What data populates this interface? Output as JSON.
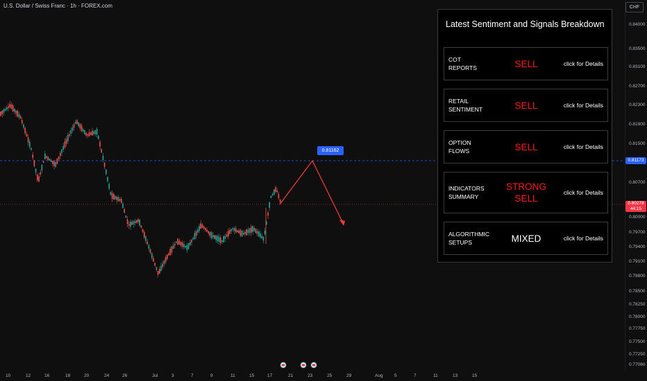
{
  "chart": {
    "title": "U.S. Dollar / Swiss Franc · 1h · FOREX.com",
    "currency": "CHF",
    "price_labels": [
      "0.84000",
      "0.83500",
      "0.83100",
      "0.82700",
      "0.82300",
      "0.81900",
      "0.81500",
      "0.81173",
      "0.80700",
      "0.80278",
      "0.80000",
      "0.79700",
      "0.79400",
      "0.79100",
      "0.78800",
      "0.78500",
      "0.78250",
      "0.78000",
      "0.77750",
      "0.77500",
      "0.77250",
      "0.77060"
    ],
    "current_price_tag": "0.81173",
    "last_price_tag": "0.80278",
    "last_price_countdown": "44:15",
    "target_callout": "0.81162",
    "time_labels": [
      "10",
      "12",
      "16",
      "18",
      "20",
      "24",
      "26",
      "Jul",
      "3",
      "7",
      "9",
      "11",
      "15",
      "17",
      "21",
      "23",
      "25",
      "29",
      "Aug",
      "5",
      "7",
      "11",
      "13",
      "15"
    ]
  },
  "panel": {
    "title": "Latest Sentiment and Signals Breakdown",
    "rows": [
      {
        "label_line1": "COT",
        "label_line2": "REPORTS",
        "signal": "SELL",
        "link": "click for Details"
      },
      {
        "label_line1": "RETAIL",
        "label_line2": "SENTIMENT",
        "signal": "SELL",
        "link": "click for Details"
      },
      {
        "label_line1": "OPTION",
        "label_line2": "FLOWS",
        "signal": "SELL",
        "link": "click for Details"
      },
      {
        "label_line1": "INDICATORS",
        "label_line2": "SUMMARY",
        "signal": "STRONG SELL",
        "link": "click for Details"
      },
      {
        "label_line1": "ALGORITHMIC",
        "label_line2": "SETUPS",
        "signal": "MIXED",
        "link": "click for Details"
      }
    ]
  },
  "colors": {
    "sell": "#ff1a1a",
    "candle_up": "#26a69a",
    "candle_down": "#ef5350",
    "accent": "#2962ff"
  }
}
